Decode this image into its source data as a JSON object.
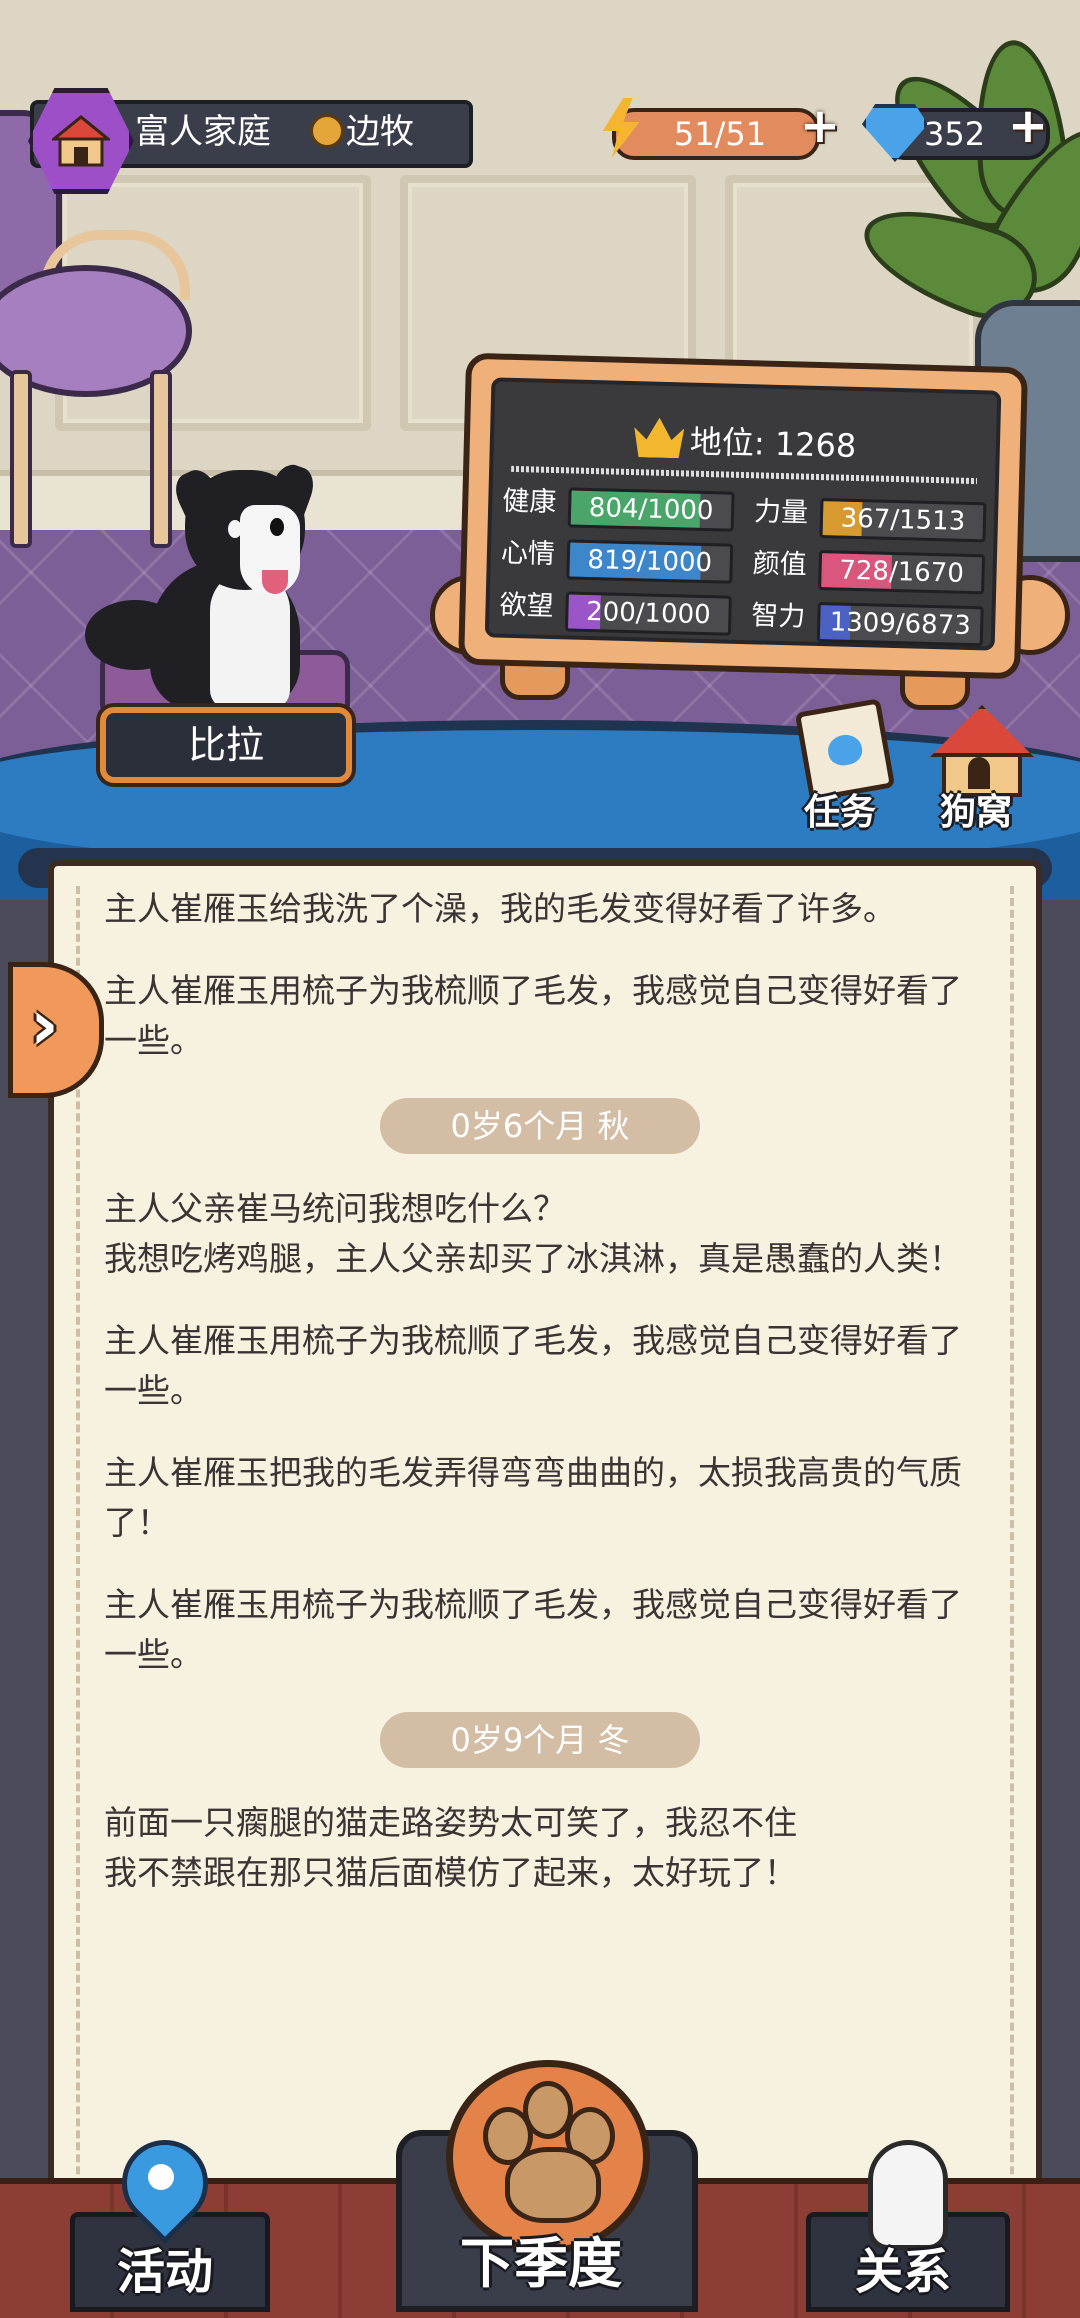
{
  "hud": {
    "family": "富人家庭",
    "career": "边牧",
    "energy": "51/51",
    "gems": "352",
    "plus": "+"
  },
  "pet": {
    "name": "比拉"
  },
  "stats_board": {
    "status_label": "地位: ",
    "status_value": "1268",
    "stats": [
      {
        "name": "健康",
        "value": "804/1000",
        "fraction": 0.804,
        "color": "#4aa56a"
      },
      {
        "name": "力量",
        "value": "367/1513",
        "fraction": 0.243,
        "color": "#d79a2f"
      },
      {
        "name": "心情",
        "value": "819/1000",
        "fraction": 0.819,
        "color": "#3c86c9"
      },
      {
        "name": "颜值",
        "value": "728/1670",
        "fraction": 0.436,
        "color": "#d9567c"
      },
      {
        "name": "欲望",
        "value": "200/1000",
        "fraction": 0.2,
        "color": "#9a55c9"
      },
      {
        "name": "智力",
        "value": "1309/6873",
        "fraction": 0.19,
        "color": "#4b62c4"
      }
    ]
  },
  "quick": {
    "tasks": "任务",
    "kennel": "狗窝"
  },
  "journal": {
    "expand_glyph": "›",
    "entries_a": [
      "主人崔雁玉给我洗了个澡，我的毛发变得好看了许多。",
      "主人崔雁玉用梳子为我梳顺了毛发，我感觉自己变得好看了一些。"
    ],
    "season_1": "0岁6个月 秋",
    "entries_b": [
      "主人父亲崔马统问我想吃什么？\n我想吃烤鸡腿，主人父亲却买了冰淇淋，真是愚蠢的人类！",
      "主人崔雁玉用梳子为我梳顺了毛发，我感觉自己变得好看了一些。",
      "主人崔雁玉把我的毛发弄得弯弯曲曲的，太损我高贵的气质了！",
      "主人崔雁玉用梳子为我梳顺了毛发，我感觉自己变得好看了一些。"
    ],
    "season_2": "0岁9个月 冬",
    "entries_c": [
      "前面一只瘸腿的猫走路姿势太可笑了，我忍不住\n我不禁跟在那只猫后面模仿了起来，太好玩了！"
    ]
  },
  "nav": {
    "activities": "活动",
    "next_season": "下季度",
    "relations": "关系"
  }
}
